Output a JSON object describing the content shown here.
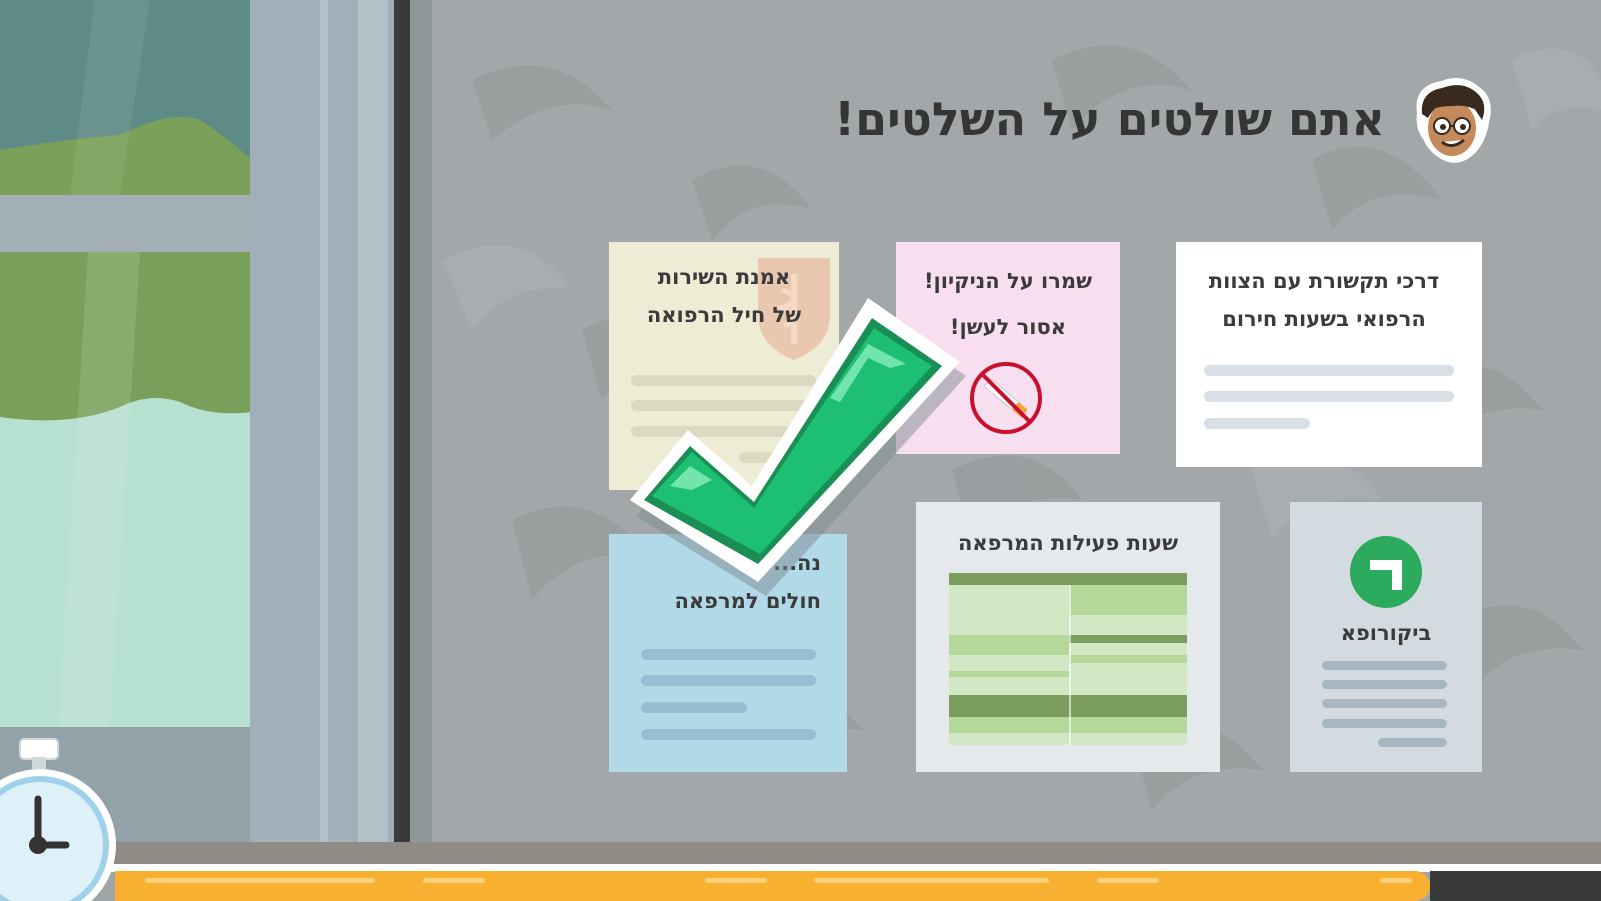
{
  "title": "אתם שולטים על השלטים!",
  "notes": {
    "medical_oath": {
      "line1": "אמנת השירות",
      "line2": "של חיל הרפואה"
    },
    "cleanliness": {
      "line1": "שמרו על הניקיון!",
      "line2": "אסור לעשן!"
    },
    "communication": {
      "line1": "דרכי תקשורת עם הצוות",
      "line2": "הרפואי בשעות חירום"
    },
    "patients": {
      "line1": "נה... ת",
      "line2": "חולים למרפאה"
    },
    "hours": {
      "title": "שעות פעילות המרפאה"
    },
    "bikurofa": {
      "label": "ביקורופא"
    }
  },
  "colors": {
    "check_green": "#1dbf73",
    "timer_orange": "#f8b030",
    "title_text": "#353535",
    "no_smoking_red": "#c8102e"
  },
  "icons": {
    "avatar": "cartoon-character-avatar",
    "feedback": "checkmark-correct-icon",
    "timer": "stopwatch-icon",
    "no_smoking": "no-smoking-icon",
    "bikurofa_logo": "bikurofa-logo-icon",
    "idf_medical_emblem": "medical-corps-emblem"
  }
}
